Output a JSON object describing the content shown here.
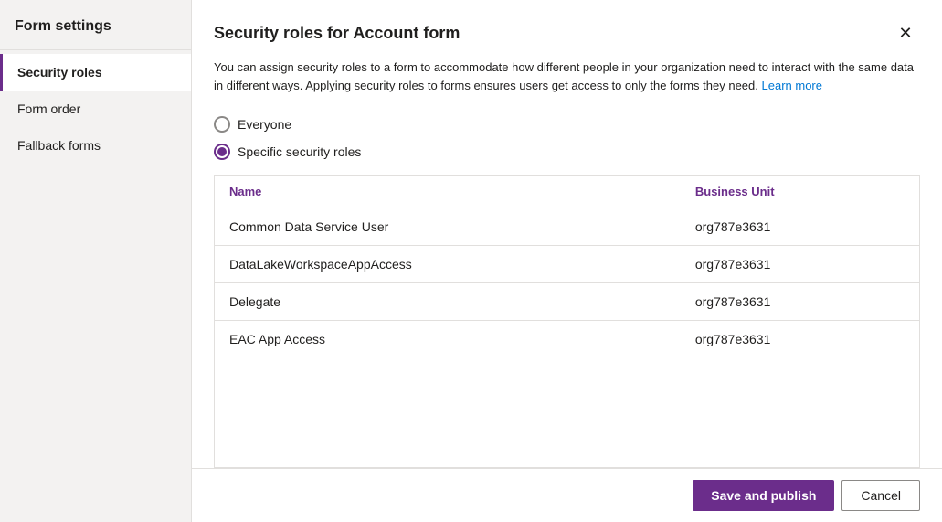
{
  "sidebar": {
    "title": "Form settings",
    "items": [
      {
        "id": "security-roles",
        "label": "Security roles",
        "active": true
      },
      {
        "id": "form-order",
        "label": "Form order",
        "active": false
      },
      {
        "id": "fallback-forms",
        "label": "Fallback forms",
        "active": false
      }
    ]
  },
  "dialog": {
    "title": "Security roles for Account form",
    "close_label": "×",
    "description": "You can assign security roles to a form to accommodate how different people in your organization need to interact with the same data in different ways. Applying security roles to forms ensures users get access to only the forms they need.",
    "learn_more_label": "Learn more",
    "radio_options": [
      {
        "id": "everyone",
        "label": "Everyone",
        "checked": false
      },
      {
        "id": "specific",
        "label": "Specific security roles",
        "checked": true
      }
    ],
    "table": {
      "columns": [
        {
          "id": "name",
          "label": "Name"
        },
        {
          "id": "business_unit",
          "label": "Business Unit"
        }
      ],
      "rows": [
        {
          "name": "Common Data Service User",
          "business_unit": "org787e3631"
        },
        {
          "name": "DataLakeWorkspaceAppAccess",
          "business_unit": "org787e3631"
        },
        {
          "name": "Delegate",
          "business_unit": "org787e3631"
        },
        {
          "name": "EAC App Access",
          "business_unit": "org787e3631"
        }
      ]
    },
    "footer": {
      "save_label": "Save and publish",
      "cancel_label": "Cancel"
    }
  }
}
